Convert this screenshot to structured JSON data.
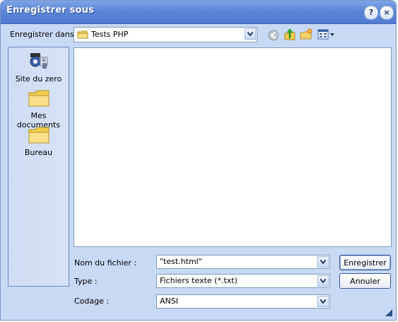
{
  "window": {
    "title": "Enregistrer sous"
  },
  "titlebar": {
    "help": "?",
    "close": "×"
  },
  "location": {
    "label": "Enregistrer dans :",
    "value": "Tests PHP"
  },
  "places": {
    "items": [
      {
        "label": "Site du zero",
        "icon": "site-du-zero-icon"
      },
      {
        "label": "Mes documents",
        "icon": "folder-icon"
      },
      {
        "label": "Bureau",
        "icon": "folder-icon"
      }
    ]
  },
  "fields": {
    "filename_label": "Nom du fichier :",
    "filename_value": "\"test.html\"",
    "type_label": "Type :",
    "type_value": "Fichiers texte (*.txt)",
    "encoding_label": "Codage :",
    "encoding_value": "ANSI"
  },
  "buttons": {
    "save": "Enregistrer",
    "cancel": "Annuler"
  },
  "colors": {
    "titlebar": "#5d86d6",
    "window_bg": "#c8d9f4",
    "border": "#7f9db9"
  }
}
